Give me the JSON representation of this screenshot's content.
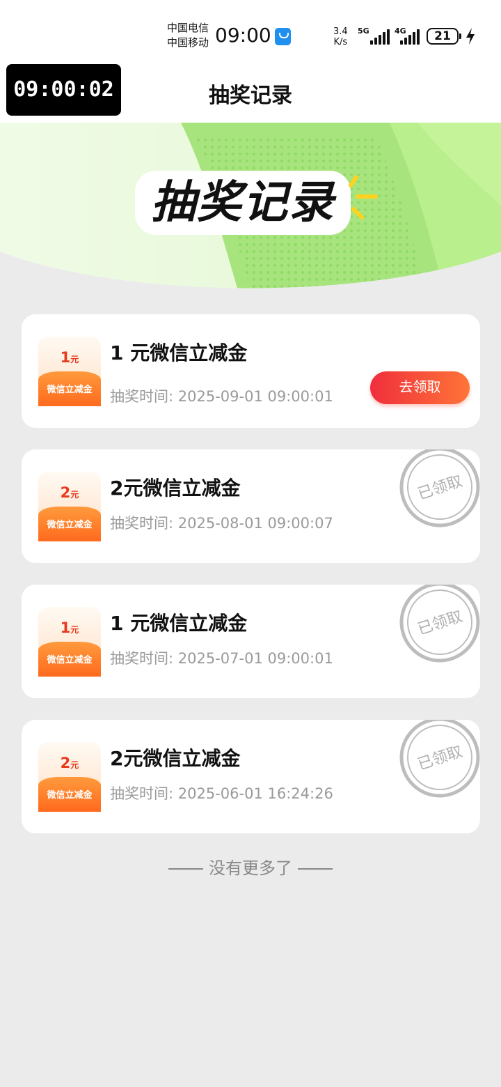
{
  "status_bar": {
    "carrier1": "中国电信",
    "carrier2": "中国移动",
    "time": "09:00",
    "net_speed_value": "3.4",
    "net_speed_unit": "K/s",
    "sig1_label": "5G",
    "sig2_label": "4G",
    "battery": "21"
  },
  "header": {
    "timer": "09:00:02",
    "title": "抽奖记录"
  },
  "banner": {
    "title": "抽奖记录"
  },
  "records": [
    {
      "coupon_value": "1",
      "coupon_unit": "元",
      "coupon_label": "微信立减金",
      "title": "1 元微信立减金",
      "time_label": "抽奖时间:",
      "time": "2025-09-01 09:00:01",
      "action": "去领取"
    },
    {
      "coupon_value": "2",
      "coupon_unit": "元",
      "coupon_label": "微信立减金",
      "title": "2元微信立减金",
      "time_label": "抽奖时间:",
      "time": "2025-08-01 09:00:07",
      "stamp": "已领取"
    },
    {
      "coupon_value": "1",
      "coupon_unit": "元",
      "coupon_label": "微信立减金",
      "title": "1 元微信立减金",
      "time_label": "抽奖时间:",
      "time": "2025-07-01 09:00:01",
      "stamp": "已领取"
    },
    {
      "coupon_value": "2",
      "coupon_unit": "元",
      "coupon_label": "微信立减金",
      "title": "2元微信立减金",
      "time_label": "抽奖时间:",
      "time": "2025-06-01 16:24:26",
      "stamp": "已领取"
    }
  ],
  "footer": {
    "no_more": "没有更多了"
  },
  "colors": {
    "accent_red": "#ef2e3c",
    "accent_orange": "#ff7538",
    "banner_green": "#9fe07a"
  }
}
